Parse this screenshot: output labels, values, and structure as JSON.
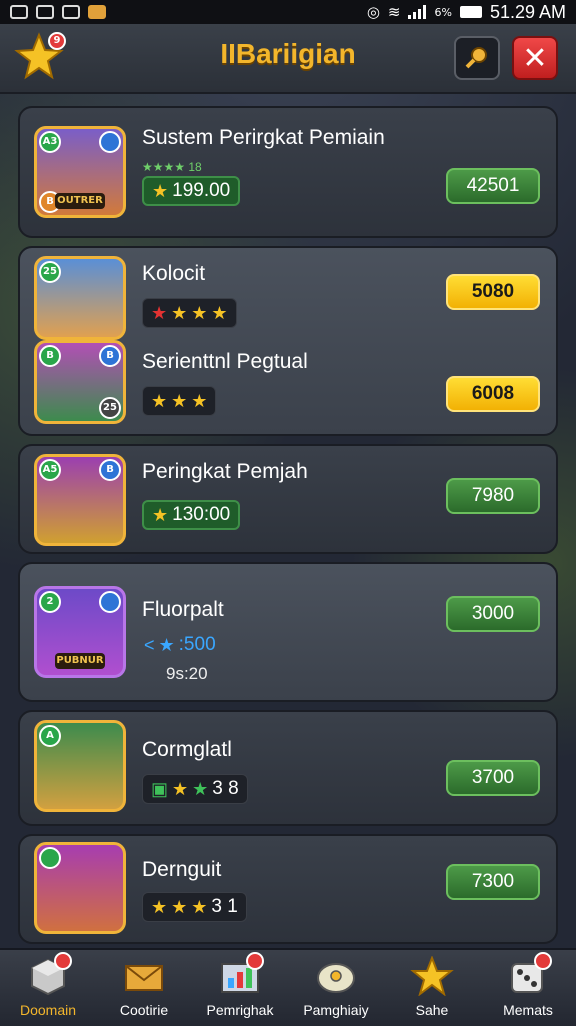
{
  "status_bar": {
    "time": "51.29 AM",
    "battery_text": "6%"
  },
  "header": {
    "title": "IIBariigian",
    "star_badge_count": "9"
  },
  "cards": [
    {
      "title": "Sustem Perirgkat Pemiain",
      "rating_text": "★★★★ 18",
      "score": "199.00",
      "button": "42501"
    },
    {
      "title": "Kolocit",
      "button": "5080",
      "title2": "Serienttnl Pegtual",
      "button2": "6008"
    },
    {
      "title": "Peringkat Pemjah",
      "score": "130:00",
      "button": "7980"
    },
    {
      "title": "Fluorpalt",
      "score": ":500",
      "sub": "9s:20",
      "button": "3000"
    },
    {
      "title": "Cormglatl",
      "score": "3 8",
      "button": "3700"
    },
    {
      "title": "Dernguit",
      "score": "3 1",
      "button": "7300"
    }
  ],
  "avatars": [
    {
      "plate": "OUTRER",
      "tl": "A3",
      "tr": "",
      "bl": "B"
    },
    {
      "plate": "",
      "tl": "25",
      "tr": "",
      "bl": ""
    },
    {
      "plate": "",
      "tl": "B",
      "tr": "B",
      "bl": "",
      "br": "25"
    },
    {
      "plate": "",
      "tl": "A5",
      "tr": "B",
      "bl": ""
    },
    {
      "plate": "PUBNUR",
      "tl": "2",
      "tr": "",
      "bl": ""
    },
    {
      "plate": "",
      "tl": "A",
      "tr": "",
      "bl": ""
    },
    {
      "plate": "",
      "tl": "",
      "tr": "",
      "bl": ""
    }
  ],
  "bottom_nav": [
    {
      "label": "Doomain",
      "icon": "cube-icon",
      "active": true
    },
    {
      "label": "Cootirie",
      "icon": "envelope-icon"
    },
    {
      "label": "Pemrighak",
      "icon": "chart-icon"
    },
    {
      "label": "Pamghiaiy",
      "icon": "disc-icon"
    },
    {
      "label": "Sahe",
      "icon": "star-icon"
    },
    {
      "label": "Memats",
      "icon": "dice-icon"
    }
  ],
  "colors": {
    "accent_gold": "#f3b62c",
    "green_button": "#4d9a48",
    "yellow_button": "#ffd21f",
    "close_red": "#e33a3a"
  }
}
